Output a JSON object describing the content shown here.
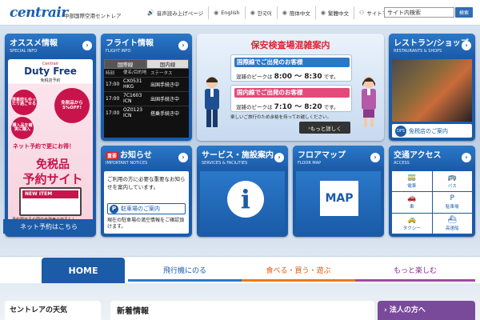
{
  "header": {
    "logo": "centrair",
    "logo_sub": "中部国際空港セントレア",
    "util": [
      {
        "icon": "speaker-icon",
        "glyph": "🔊",
        "label": "音声読み上げページ"
      },
      {
        "icon": "globe-icon",
        "glyph": "◉",
        "label": "English"
      },
      {
        "icon": "globe-icon",
        "glyph": "◉",
        "label": "한국어"
      },
      {
        "icon": "globe-icon",
        "glyph": "◉",
        "label": "簡体中文"
      },
      {
        "icon": "globe-icon",
        "glyph": "◉",
        "label": "繁體中文"
      },
      {
        "icon": "sitemap-icon",
        "glyph": "⚇",
        "label": "サイトマップ"
      }
    ],
    "search_value": "サイト内検索",
    "search_button": "検索"
  },
  "osusume": {
    "title": "オススメ情報",
    "sub": "SPECIAL INFO",
    "df_brand": "Centrair",
    "df_title": "Duty Free",
    "df_sub": "免税店予約",
    "c1": "搭乗前もゆったり過ごせる",
    "c2": "免税品から5%OFF!",
    "c3": "購入品を確実に購入",
    "net": "ネット予約で更にお得！",
    "big1": "免税品",
    "big2": "予約サイト",
    "new_item": "NEW ITEM",
    "note": "予約限定品や国内未発売の商品も！",
    "button": "ネット予約はこちら"
  },
  "flight": {
    "title": "フライト情報",
    "sub": "FLIGHT INFO",
    "tab_intl": "国際線",
    "tab_dom": "国内線",
    "cols": [
      "時刻",
      "便名/目的地",
      "ステータス"
    ],
    "rows": [
      {
        "time": "17:00",
        "flight": "CX0531 HKG",
        "status": "出国手続き中"
      },
      {
        "time": "17:00",
        "flight": "7C1603 ICN",
        "status": "出国手続き中"
      },
      {
        "time": "17:00",
        "flight": "OZ0123 ICN",
        "status": "搭乗手続き中"
      }
    ]
  },
  "hero": {
    "title": "保安検査場混雑案内",
    "intl_label": "国際線でご出発のお客様",
    "intl_peak_prefix": "混雑のピークは",
    "intl_peak": "8:00 ～ 8:30",
    "intl_suffix": "です。",
    "dom_label": "国内線でご出発のお客様",
    "dom_peak_prefix": "混雑のピークは",
    "dom_peak": "7:10 ～ 8:20",
    "dom_suffix": "です。",
    "note": "楽しいご旅行のため余裕を持ってお越しください。",
    "button": "もっと詳しく"
  },
  "rest": {
    "title": "レストラン/ショップ",
    "sub": "RESTAURANTS & SHOPS",
    "dfs": "DFS",
    "button": "免税店のご案内"
  },
  "news": {
    "badge": "重要",
    "title": "お知らせ",
    "sub": "IMPORTANT NOTICES",
    "text": "ご利用の方に必要な重要なお知らせを案内しています。",
    "parking": "駐車場のご案内",
    "parking_text": "現在の駐車場の満空情報をご確認頂けます。"
  },
  "service": {
    "title": "サービス・施設案内",
    "sub": "SERVICES & FACILITIES",
    "icon_text": "i"
  },
  "floor": {
    "title": "フロアマップ",
    "sub": "FLOOR MAP",
    "icon_text": "MAP"
  },
  "access": {
    "title": "交通アクセス",
    "sub": "ACCESS",
    "items": [
      {
        "glyph": "🚃",
        "label": "電車"
      },
      {
        "glyph": "🚌",
        "label": "バス"
      },
      {
        "glyph": "🚗",
        "label": "車"
      },
      {
        "glyph": "P",
        "label": "駐車場"
      },
      {
        "glyph": "🚕",
        "label": "タクシー"
      },
      {
        "glyph": "⛴",
        "label": "高速船"
      }
    ]
  },
  "nav": {
    "home": "HOME",
    "fly": "飛行機にのる",
    "eat": "食べる・買う・遊ぶ",
    "fun": "もっと楽しむ"
  },
  "bottom": {
    "weather": "セントレアの天気",
    "whatsnew": "新着情報",
    "corp": "法人の方へ"
  }
}
